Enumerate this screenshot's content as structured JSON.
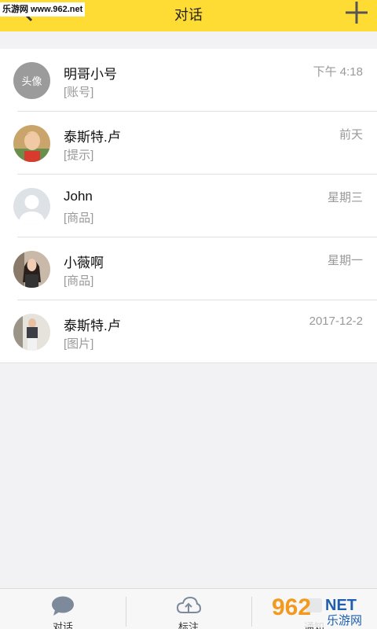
{
  "watermark": "乐游网 www.962.net",
  "header": {
    "title": "对话"
  },
  "conversations": [
    {
      "name": "明哥小号",
      "preview": "[账号]",
      "time": "下午 4:18",
      "avatar_text": "头像"
    },
    {
      "name": "泰斯特.卢",
      "preview": "[提示]",
      "time": "前天"
    },
    {
      "name": "John",
      "preview": "[商品]",
      "time": "星期三"
    },
    {
      "name": "小薇啊",
      "preview": "[商品]",
      "time": "星期一"
    },
    {
      "name": "泰斯特.卢",
      "preview": "[图片]",
      "time": "2017-12-2"
    }
  ],
  "tabs": [
    {
      "label": "对话",
      "icon": "chat-bubble-icon"
    },
    {
      "label": "标注",
      "icon": "cloud-upload-icon"
    },
    {
      "label": "通知",
      "icon": "notification-icon"
    }
  ],
  "logo": {
    "number": "962",
    "net": "NET",
    "cn": "乐游网"
  },
  "colors": {
    "header": "#ffdc33",
    "tab_icon": "#7d8a9c",
    "logo_orange": "#f39a1e",
    "logo_blue": "#1f5fae"
  }
}
